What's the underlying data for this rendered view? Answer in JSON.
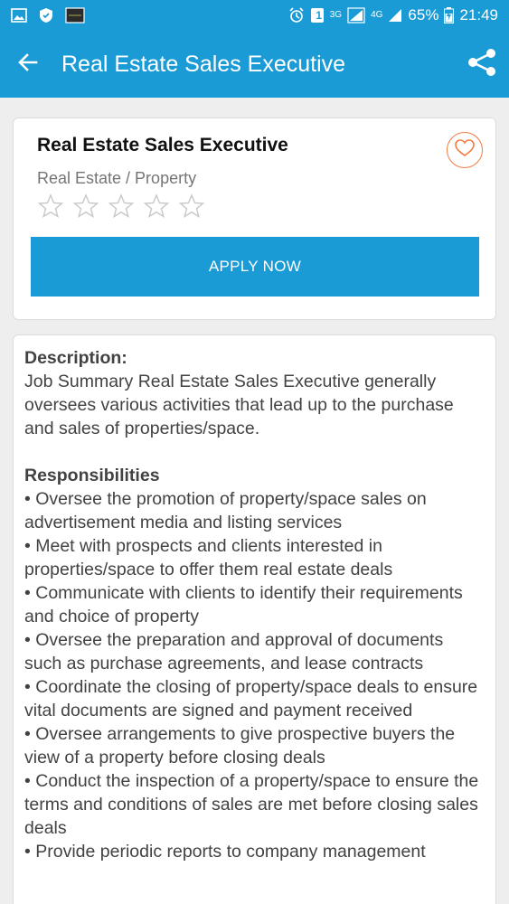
{
  "status_bar": {
    "network_3g": "3G",
    "network_4g": "4G",
    "battery": "65%",
    "time": "21:49",
    "sim_badge": "1"
  },
  "app_bar": {
    "title": "Real Estate Sales Executive"
  },
  "job": {
    "title": "Real Estate Sales Executive",
    "category": "Real Estate / Property",
    "rating_stars": 5,
    "rating_filled": 0,
    "apply_label": "APPLY NOW"
  },
  "details": {
    "description_heading": "Description:",
    "description_text": "Job Summary Real Estate Sales Executive generally oversees various activities that lead up to the purchase and sales of properties/space.",
    "responsibilities_heading": "Responsibilities",
    "responsibilities": [
      "• Oversee the promotion of property/space sales on advertisement media and listing services",
      "• Meet with prospects and clients interested in properties/space to offer them real estate deals",
      "• Communicate with clients to identify their requirements and choice of property",
      "• Oversee the preparation and approval of documents such as purchase agreements, and lease contracts",
      "• Coordinate the closing of property/space deals to ensure vital documents are signed and payment received",
      "• Oversee arrangements to give prospective buyers the view of a property before closing deals",
      "• Conduct the inspection of a property/space to ensure the terms and conditions of sales are met before closing sales deals",
      "• Provide periodic reports to company management"
    ]
  },
  "icons": {
    "back": "arrow-left-icon",
    "share": "share-icon",
    "favorite": "heart-outline-icon",
    "star": "star-outline-icon"
  },
  "colors": {
    "primary": "#1a9bd6",
    "accent": "#f07c3e",
    "background": "#eeeeee",
    "star": "#c8c8c8"
  }
}
